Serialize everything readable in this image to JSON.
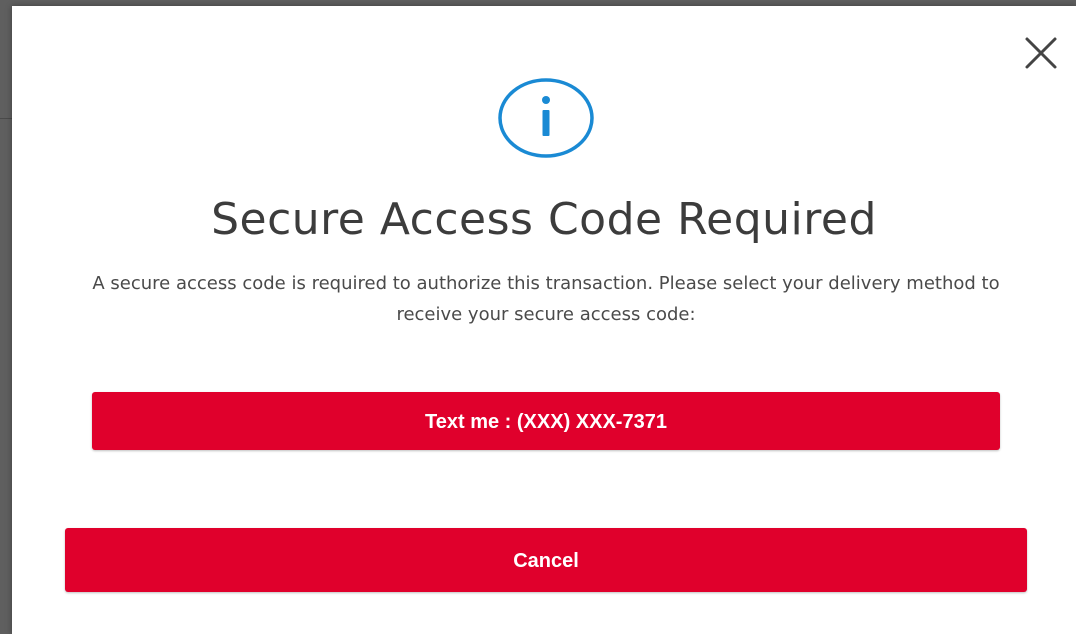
{
  "dialog": {
    "title": "Secure Access Code Required",
    "message": "A secure access code is required to authorize this transaction. Please select your delivery method to receive your secure access code:",
    "icon": "info-icon",
    "close_icon": "close-icon",
    "text_me_label": "Text me : (XXX) XXX-7371",
    "cancel_label": "Cancel"
  },
  "colors": {
    "accent": "#e0002c",
    "info_blue": "#1a8ad4",
    "title_text": "#3c3c3c",
    "body_text": "#4a4a4a"
  }
}
